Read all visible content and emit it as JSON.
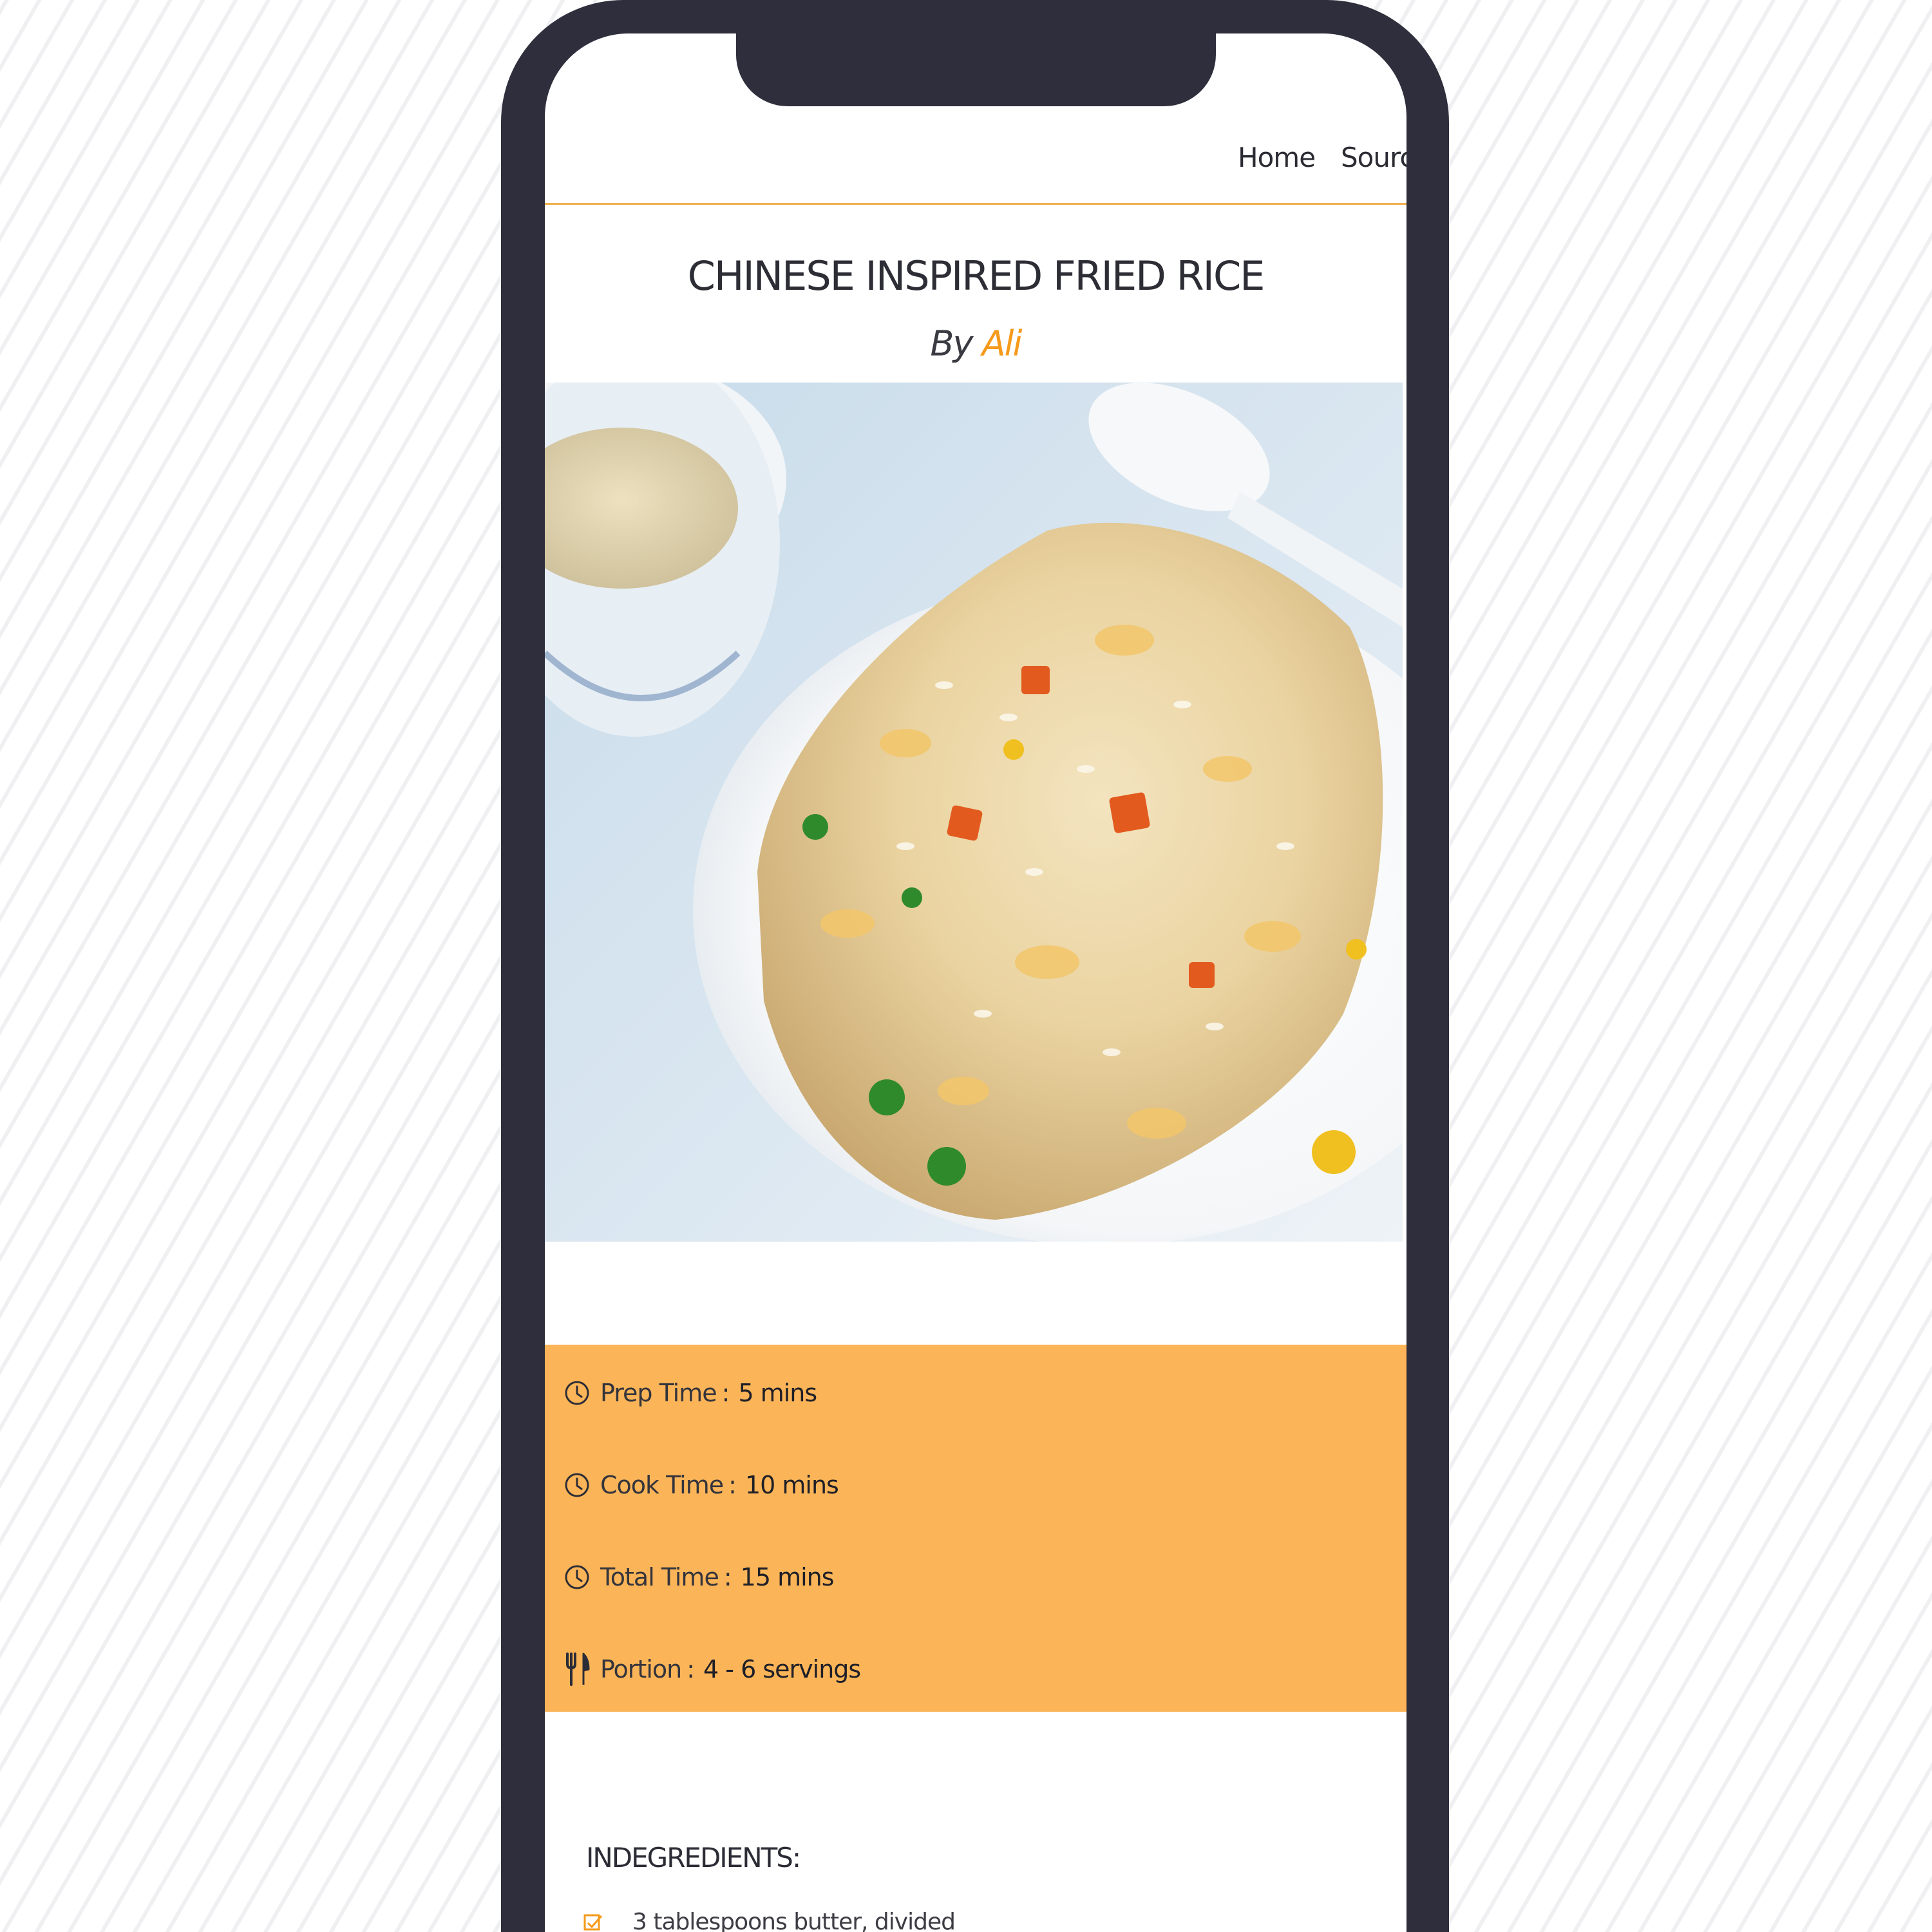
{
  "nav": {
    "links": [
      {
        "label": "Home"
      },
      {
        "label": "Source"
      }
    ]
  },
  "recipe": {
    "title": "CHINESE INSPIRED FRIED RICE",
    "by_prefix": "By",
    "author": "Ali",
    "image_subject": "plate of fried rice with egg, carrot, peas and corn, with a bowl of soup and a spoon"
  },
  "details": [
    {
      "icon": "clock-icon",
      "label": "Prep Time",
      "separator": ":",
      "value": "5 mins"
    },
    {
      "icon": "clock-icon",
      "label": "Cook Time",
      "separator": ":",
      "value": "10 mins"
    },
    {
      "icon": "clock-icon",
      "label": "Total Time",
      "separator": ":",
      "value": "15 mins"
    },
    {
      "icon": "fork-knife-icon",
      "label": "Portion",
      "separator": ":",
      "value": "4 - 6 servings"
    }
  ],
  "ingredients": {
    "heading": "INDEGREDIENTS:",
    "items": [
      {
        "text": "3 tablespoons butter, divided"
      }
    ]
  },
  "colors": {
    "frame": "#2e2e3d",
    "accent": "#fbb558",
    "author": "#f59a1b",
    "nav_rule": "#f0b04e"
  }
}
